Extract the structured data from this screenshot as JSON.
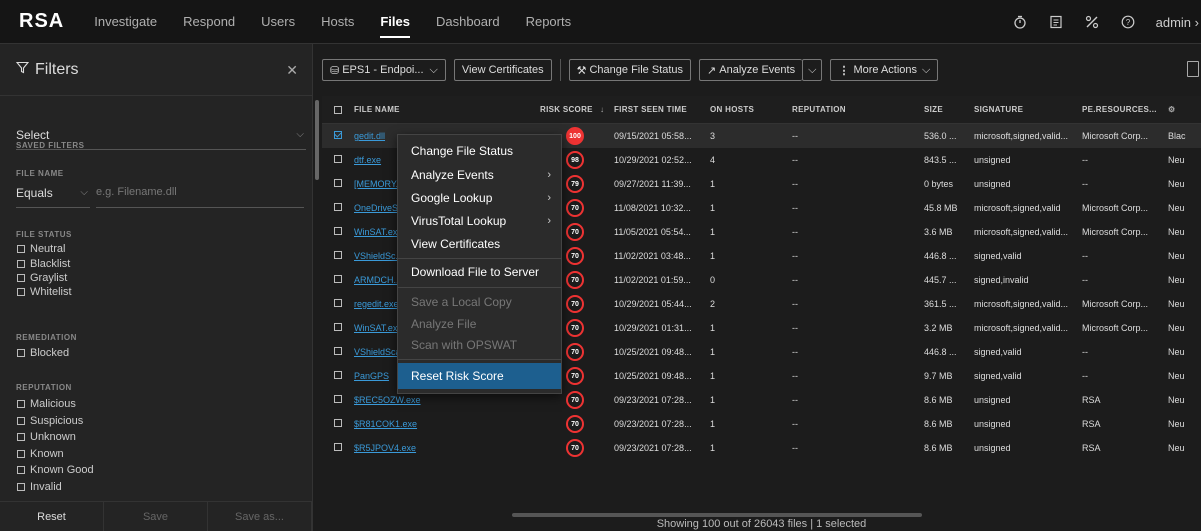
{
  "nav": {
    "logo": "RSA",
    "items": [
      "Investigate",
      "Respond",
      "Users",
      "Hosts",
      "Files",
      "Dashboard",
      "Reports"
    ],
    "active": "Files",
    "user": "admin"
  },
  "filters": {
    "title": "Filters",
    "saved_filters_label": "SAVED FILTERS",
    "saved_filters_value": "Select",
    "file_name_label": "FILE NAME",
    "file_name_operator": "Equals",
    "file_name_placeholder": "e.g. Filename.dll",
    "file_status_label": "FILE STATUS",
    "file_status_options": [
      "Neutral",
      "Blacklist",
      "Graylist",
      "Whitelist"
    ],
    "remediation_label": "REMEDIATION",
    "remediation_options": [
      "Blocked"
    ],
    "reputation_label": "REPUTATION",
    "reputation_options": [
      "Malicious",
      "Suspicious",
      "Unknown",
      "Known",
      "Known Good",
      "Invalid"
    ],
    "reset_label": "Reset",
    "save_label": "Save",
    "save_as_label": "Save as..."
  },
  "toolbar": {
    "server": "EPS1 - Endpoi...",
    "view_certificates": "View Certificates",
    "change_file_status": "Change File Status",
    "analyze_events": "Analyze Events",
    "more_actions": "More Actions"
  },
  "table": {
    "columns": [
      "FILE NAME",
      "RISK SCORE",
      "FIRST SEEN TIME",
      "ON HOSTS",
      "REPUTATION",
      "SIZE",
      "SIGNATURE",
      "PE.RESOURCES..."
    ],
    "rows": [
      {
        "name": "gedit.dll",
        "risk": "100",
        "seen": "09/15/2021 05:58...",
        "hosts": "3",
        "rep": "--",
        "size": "536.0 ...",
        "sig": "microsoft,signed,valid...",
        "pe": "Microsoft Corp...",
        "status": "Blac",
        "checked": true
      },
      {
        "name": "dtf.exe",
        "risk": "98",
        "seen": "10/29/2021 02:52...",
        "hosts": "4",
        "rep": "--",
        "size": "843.5 ...",
        "sig": "unsigned",
        "pe": "--",
        "status": "Neu",
        "checked": false
      },
      {
        "name": "[MEMORY...",
        "risk": "79",
        "seen": "09/27/2021 11:39...",
        "hosts": "1",
        "rep": "--",
        "size": "0 bytes",
        "sig": "unsigned",
        "pe": "--",
        "status": "Neu",
        "checked": false
      },
      {
        "name": "OneDriveS...",
        "risk": "70",
        "seen": "11/08/2021 10:32...",
        "hosts": "1",
        "rep": "--",
        "size": "45.8 MB",
        "sig": "microsoft,signed,valid",
        "pe": "Microsoft Corp...",
        "status": "Neu",
        "checked": false
      },
      {
        "name": "WinSAT.ex...",
        "risk": "70",
        "seen": "11/05/2021 05:54...",
        "hosts": "1",
        "rep": "--",
        "size": "3.6 MB",
        "sig": "microsoft,signed,valid...",
        "pe": "Microsoft Corp...",
        "status": "Neu",
        "checked": false
      },
      {
        "name": "VShieldSc...",
        "risk": "70",
        "seen": "11/02/2021 03:48...",
        "hosts": "1",
        "rep": "--",
        "size": "446.8 ...",
        "sig": "signed,valid",
        "pe": "--",
        "status": "Neu",
        "checked": false
      },
      {
        "name": "ARMDCH...",
        "risk": "70",
        "seen": "11/02/2021 01:59...",
        "hosts": "0",
        "rep": "--",
        "size": "445.7 ...",
        "sig": "signed,invalid",
        "pe": "--",
        "status": "Neu",
        "checked": false
      },
      {
        "name": "regedit.exe",
        "risk": "70",
        "seen": "10/29/2021 05:44...",
        "hosts": "2",
        "rep": "--",
        "size": "361.5 ...",
        "sig": "microsoft,signed,valid...",
        "pe": "Microsoft Corp...",
        "status": "Neu",
        "checked": false
      },
      {
        "name": "WinSAT.ex...",
        "risk": "70",
        "seen": "10/29/2021 01:31...",
        "hosts": "1",
        "rep": "--",
        "size": "3.2 MB",
        "sig": "microsoft,signed,valid...",
        "pe": "Microsoft Corp...",
        "status": "Neu",
        "checked": false
      },
      {
        "name": "VShieldScanner",
        "risk": "70",
        "seen": "10/25/2021 09:48...",
        "hosts": "1",
        "rep": "--",
        "size": "446.8 ...",
        "sig": "signed,valid",
        "pe": "--",
        "status": "Neu",
        "checked": false
      },
      {
        "name": "PanGPS",
        "risk": "70",
        "seen": "10/25/2021 09:48...",
        "hosts": "1",
        "rep": "--",
        "size": "9.7 MB",
        "sig": "signed,valid",
        "pe": "--",
        "status": "Neu",
        "checked": false
      },
      {
        "name": "$REC5OZW.exe",
        "risk": "70",
        "seen": "09/23/2021 07:28...",
        "hosts": "1",
        "rep": "--",
        "size": "8.6 MB",
        "sig": "unsigned",
        "pe": "RSA",
        "status": "Neu",
        "checked": false
      },
      {
        "name": "$R81COK1.exe",
        "risk": "70",
        "seen": "09/23/2021 07:28...",
        "hosts": "1",
        "rep": "--",
        "size": "8.6 MB",
        "sig": "unsigned",
        "pe": "RSA",
        "status": "Neu",
        "checked": false
      },
      {
        "name": "$R5JPOV4.exe",
        "risk": "70",
        "seen": "09/23/2021 07:28...",
        "hosts": "1",
        "rep": "--",
        "size": "8.6 MB",
        "sig": "unsigned",
        "pe": "RSA",
        "status": "Neu",
        "checked": false
      }
    ],
    "footer": "Showing 100 out of 26043 files | 1 selected"
  },
  "context_menu": {
    "change_file_status": "Change File Status",
    "analyze_events": "Analyze Events",
    "google_lookup": "Google Lookup",
    "virustotal_lookup": "VirusTotal Lookup",
    "view_certificates": "View Certificates",
    "download_file": "Download File to Server",
    "save_local_copy": "Save a Local Copy",
    "analyze_file": "Analyze File",
    "scan_opswat": "Scan with OPSWAT",
    "reset_risk_score": "Reset Risk Score"
  }
}
